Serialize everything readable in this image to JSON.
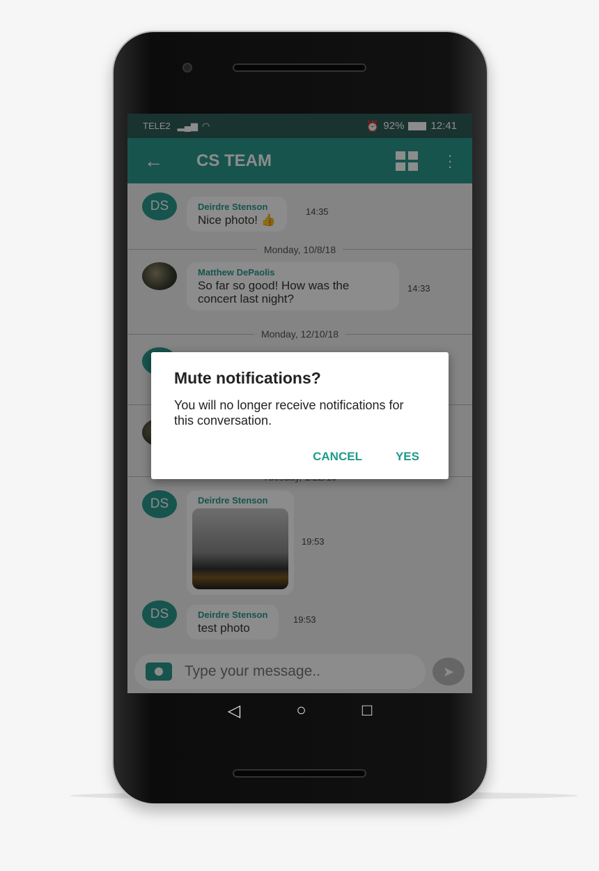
{
  "status": {
    "carrier": "TELE2",
    "battery": "92%",
    "time": "12:41"
  },
  "header": {
    "title": "CS TEAM"
  },
  "messages": [
    {
      "initials": "DS",
      "name": "Deirdre Stenson",
      "text": "Nice photo! 👍",
      "time": "14:35"
    },
    {
      "date": "Monday, 10/8/18"
    },
    {
      "name": "Matthew DePaolis",
      "text": "So far so good! How was the concert last night?",
      "time": "14:33"
    },
    {
      "date": "Monday, 12/10/18"
    },
    {
      "date": "Tuesday, 1/22/19"
    },
    {
      "initials": "DS",
      "name": "Deirdre Stenson",
      "time": "19:53"
    },
    {
      "initials": "DS",
      "name": "Deirdre Stenson",
      "text": "test photo",
      "time": "19:53"
    }
  ],
  "composer": {
    "placeholder": "Type your message.."
  },
  "dialog": {
    "title": "Mute notifications?",
    "body": "You will no longer receive notifications for this conversation.",
    "cancel": "CANCEL",
    "yes": "YES"
  },
  "colors": {
    "accent": "#2a9a8c"
  }
}
